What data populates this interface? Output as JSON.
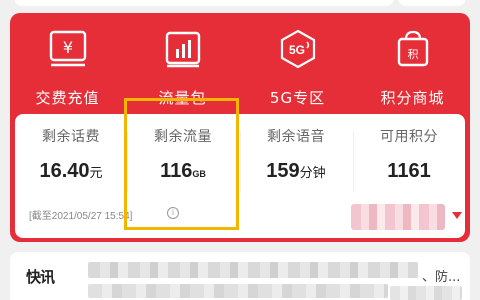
{
  "services": [
    {
      "label": "交费充值",
      "icon": "yuan-card-icon"
    },
    {
      "label": "流量包",
      "icon": "bar-chart-icon"
    },
    {
      "label": "5G专区",
      "icon": "5g-icon"
    },
    {
      "label": "积分商城",
      "icon": "points-bag-icon"
    }
  ],
  "stats": [
    {
      "title": "剩余话费",
      "value": "16.40",
      "unit": "元"
    },
    {
      "title": "剩余流量",
      "value": "116",
      "unit": "GB"
    },
    {
      "title": "剩余语音",
      "value": "159",
      "unit": "分钟"
    },
    {
      "title": "可用积分",
      "value": "1161",
      "unit": ""
    }
  ],
  "date_note": "[截至2021/05/27 15:54]",
  "info_icon_glyph": "i",
  "news": {
    "logo": "快讯",
    "text": "、防..."
  },
  "colors": {
    "brand_red": "#e62e39",
    "highlight": "#f2b600"
  }
}
